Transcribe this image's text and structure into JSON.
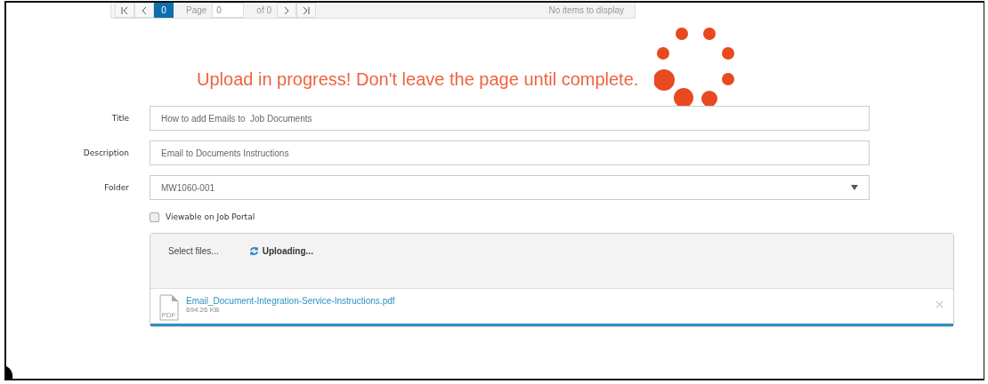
{
  "pager": {
    "current_page": "0",
    "page_label": "Page",
    "page_value": "0",
    "of_label": "of 0",
    "status": "No items to display"
  },
  "upload_message": "Upload in progress! Don't leave the page until complete.",
  "fields": [
    {
      "label": "Title",
      "kind": "text",
      "value": "How to add Emails to  Job Documents"
    },
    {
      "label": "Description",
      "kind": "text",
      "value": "Email to Documents Instructions"
    },
    {
      "label": "Folder",
      "kind": "select",
      "value": "MW1060-001"
    }
  ],
  "viewable_on_job_portal": {
    "label": "Viewable on Job Portal",
    "checked": false
  },
  "upload": {
    "select_label": "Select files...",
    "status": "Uploading...",
    "files": [
      {
        "name": "Email_Document-Integration-Service-Instructions.pdf",
        "size": "694.26 KB",
        "icon_label": "PDF",
        "level": 1
      }
    ]
  }
}
